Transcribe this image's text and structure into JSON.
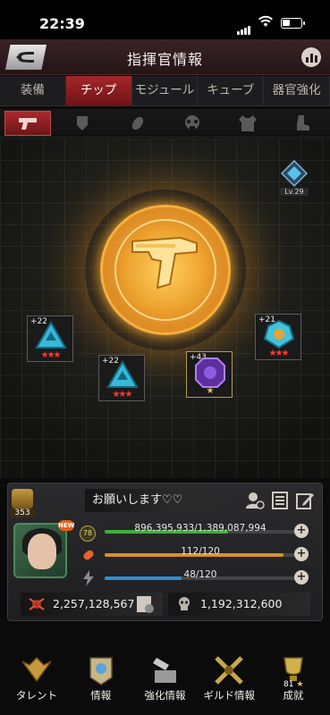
{
  "status_bar": {
    "time": "22:39"
  },
  "header": {
    "title": "指揮官情報"
  },
  "tabs": [
    {
      "label": "装備",
      "active": false
    },
    {
      "label": "チップ",
      "active": true
    },
    {
      "label": "モジュール",
      "active": false
    },
    {
      "label": "キューブ",
      "active": false
    },
    {
      "label": "器官強化",
      "active": false
    }
  ],
  "subcategories": [
    "pistol-icon",
    "shield-icon",
    "blade-icon",
    "mask-icon",
    "vest-icon",
    "boot-icon"
  ],
  "stage": {
    "badge_level": "Lv.29",
    "chips": [
      {
        "level": "+22",
        "stars": "★★★"
      },
      {
        "level": "+22",
        "stars": "★★★"
      },
      {
        "level": "+43",
        "stars": "★"
      },
      {
        "level": "+21",
        "stars": "★★★"
      }
    ]
  },
  "commander": {
    "rank_number": "353",
    "name": "お願いします♡♡",
    "new_tag": "NEW",
    "level": "78",
    "hp": {
      "text": "896,395,933/1,389,087,994",
      "fraction": 0.645
    },
    "fuel": {
      "text": "112/120",
      "fraction": 0.933
    },
    "energy": {
      "text": "48/120",
      "fraction": 0.4
    },
    "power": "2,257,128,567",
    "kills": "1,192,312,600"
  },
  "bottom_nav": [
    {
      "label": "タレント",
      "icon": "talent-icon"
    },
    {
      "label": "情報",
      "icon": "info-icon"
    },
    {
      "label": "強化情報",
      "icon": "enhance-icon"
    },
    {
      "label": "ギルド情報",
      "icon": "guild-icon"
    },
    {
      "label": "成就",
      "icon": "achievement-icon",
      "count": "81"
    }
  ],
  "colors": {
    "accent": "#a5272b",
    "hp_bar": "#3fae3a",
    "fuel_bar": "#d8902a",
    "energy_bar": "#2f8fd8"
  }
}
